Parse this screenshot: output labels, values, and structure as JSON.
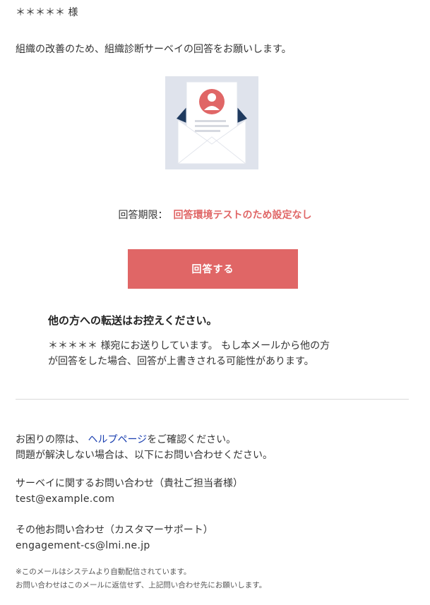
{
  "recipient": "＊＊＊＊＊ 様",
  "intro": "組織の改善のため、組織診断サーベイの回答をお願いします。",
  "deadline": {
    "label": "回答期限：",
    "value": "回答環境テストのため設定なし"
  },
  "answer_button": "回答する",
  "notice": {
    "title": "他の方への転送はお控えください。",
    "line1": "＊＊＊＊＊ 様宛にお送りしています。 もし本メールから他の方",
    "line2": "が回答をした場合、回答が上書きされる可能性があります。"
  },
  "help": {
    "prefix": "お困りの際は、 ",
    "link": "ヘルプページ",
    "suffix": "をご確認ください。",
    "line2": "問題が解決しない場合は、以下にお問い合わせください。"
  },
  "contacts": {
    "survey_label": "サーベイに関するお問い合わせ（貴社ご担当者様）",
    "survey_email": "test@example.com",
    "other_label": "その他お問い合わせ（カスタマーサポート）",
    "other_email": "engagement-cs@lmi.ne.jp"
  },
  "footer": {
    "line1": "※このメールはシステムより自動配信されています。",
    "line2": "お問い合わせはこのメールに返信せず、上記問い合わせ先にお願いします。"
  },
  "colors": {
    "accent": "#e06666",
    "link": "#1a3fb0",
    "envelope_bg": "#dfe3ec",
    "envelope_flap": "#1f3a5f"
  }
}
